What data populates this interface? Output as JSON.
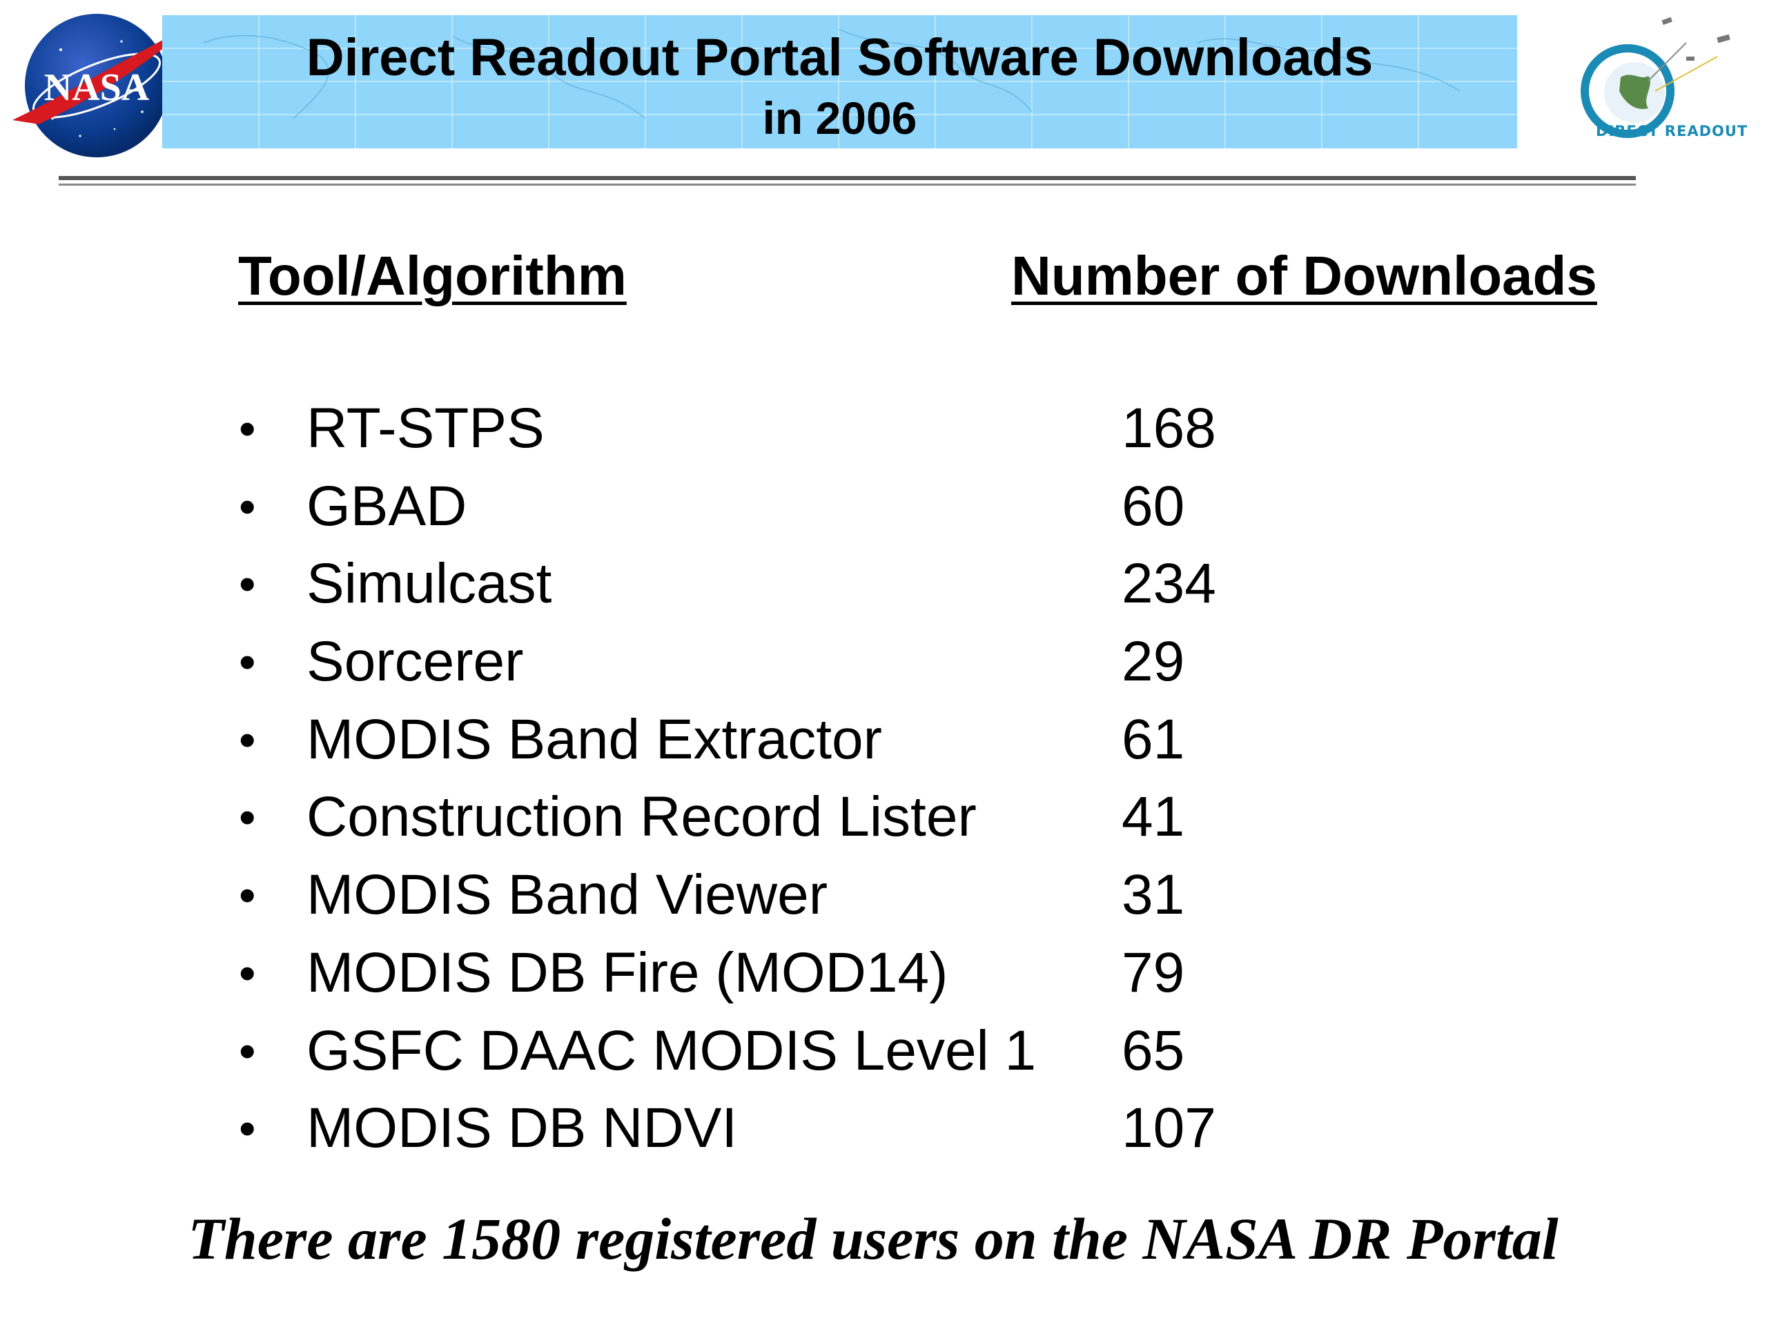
{
  "header": {
    "title": "Direct Readout Portal Software Downloads",
    "subtitle": "in 2006",
    "nasa_logo_text": "NASA",
    "dr_logo_text": "DIRECT READOUT",
    "banner_color": "#8fd6fa"
  },
  "columns": {
    "tool": "Tool/Algorithm",
    "count": "Number of Downloads"
  },
  "items": [
    {
      "name": "RT-STPS",
      "downloads": "168"
    },
    {
      "name": "GBAD",
      "downloads": "60"
    },
    {
      "name": "Simulcast",
      "downloads": "234"
    },
    {
      "name": "Sorcerer",
      "downloads": "29"
    },
    {
      "name": "MODIS Band Extractor",
      "downloads": "61"
    },
    {
      "name": "Construction Record Lister",
      "downloads": "41"
    },
    {
      "name": "MODIS Band Viewer",
      "downloads": "31"
    },
    {
      "name": "MODIS DB Fire (MOD14)",
      "downloads": "79"
    },
    {
      "name": "GSFC DAAC MODIS Level 1",
      "downloads": "65"
    },
    {
      "name": "MODIS DB NDVI",
      "downloads": "107"
    }
  ],
  "footer": {
    "note": "There are 1580 registered users on the NASA DR Portal"
  },
  "bullet_char": "•"
}
